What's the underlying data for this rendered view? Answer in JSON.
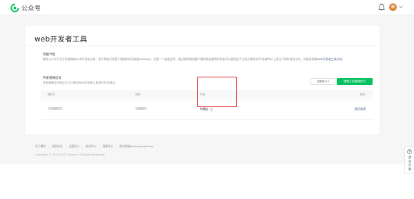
{
  "header": {
    "brand": "公众号",
    "brand_color": "#07c160",
    "icons": [
      "wechat-logo-icon",
      "bell-icon",
      "avatar",
      "chevron-down-icon"
    ]
  },
  "page": {
    "title": "web开发者工具"
  },
  "intro": {
    "title": "功能介绍",
    "description": "绑定公众号平台开发者微信web开发者工具，用于帮助开发基于微信的网页或者webapp。它是一个桌面应用，通过模拟微信客户端的表现使得开发者可以使用这个工具方便地在PC或者Mac上进行开发和调试工作。详细请参看",
    "link_text": "web开发者工具文档",
    "tail": "。"
  },
  "bind": {
    "title": "开发者微信号",
    "description": "开发者微信号绑定后可以使用web开发者工具进行开发调试。",
    "invite_button": "已邀请1/15",
    "bind_button": "绑定开发者微信号"
  },
  "table": {
    "headers": [
      "微信号",
      "昵称",
      "状态",
      "操作"
    ],
    "rows": [
      {
        "status": "待确定",
        "action": "撤回邀请"
      }
    ]
  },
  "footer": {
    "links": [
      "关于腾讯",
      "服务协议",
      "运营中心",
      "辟谣中心",
      "客服中心",
      "联系邮箱weixingongzhong"
    ],
    "copyright": "Copyright © 2012-2023 Tencent. All Rights Reserved."
  },
  "side_help": {
    "label": "遇到问题"
  },
  "colors": {
    "primary": "#07c160",
    "link": "#576b95",
    "highlight": "#e02020",
    "background": "#f6f6f6"
  }
}
